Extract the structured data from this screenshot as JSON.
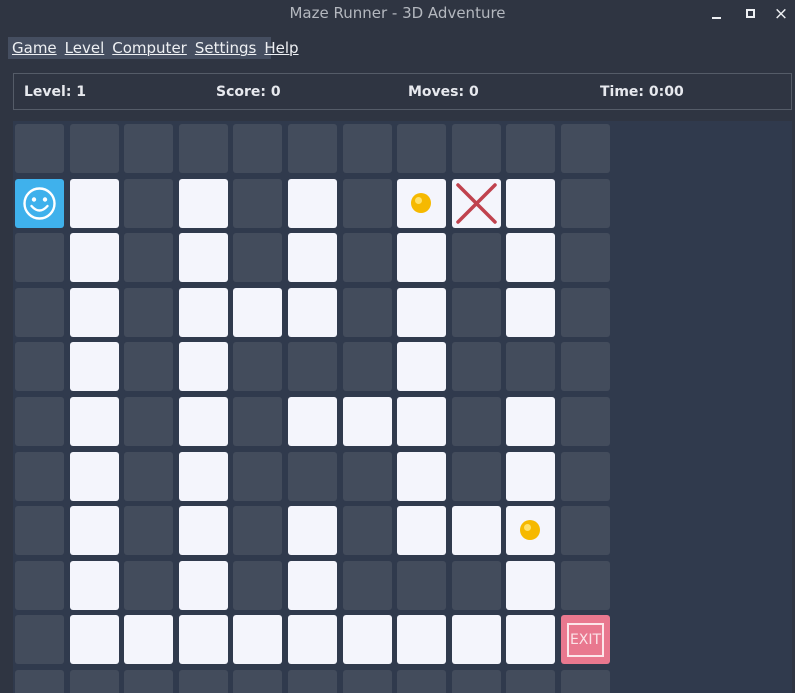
{
  "window": {
    "title": "Maze Runner - 3D Adventure",
    "min_glyph": "_",
    "max_glyph": "□",
    "close_glyph": "×"
  },
  "menu": [
    "Game",
    "Level",
    "Computer",
    "Settings",
    "Help"
  ],
  "status": {
    "level": "Level: 1",
    "score": "Score: 0",
    "moves": "Moves: 0",
    "time": "Time: 0:00"
  },
  "exit_label": "EXIT",
  "colors": {
    "wall": "#434c5c",
    "path": "#f4f5fc",
    "player": "#3fb1ec",
    "exit": "#e9788f",
    "coin": "#f6b900",
    "trap": "#c0424e"
  },
  "legend": {
    "#": "wall",
    ".": "path",
    "P": "player",
    "C": "coin",
    "T": "trap",
    "E": "exit"
  },
  "maze": [
    "###########",
    "P.#.#.#CT.#",
    "#.#.#.#.#.#",
    "#.#...#.#.#",
    "#.#.###.###",
    "#.#.#...#.#",
    "#.#.###.#.#",
    "#.#.#.#..C#",
    "#.#.#.###.#",
    "#.........E",
    "###########"
  ]
}
